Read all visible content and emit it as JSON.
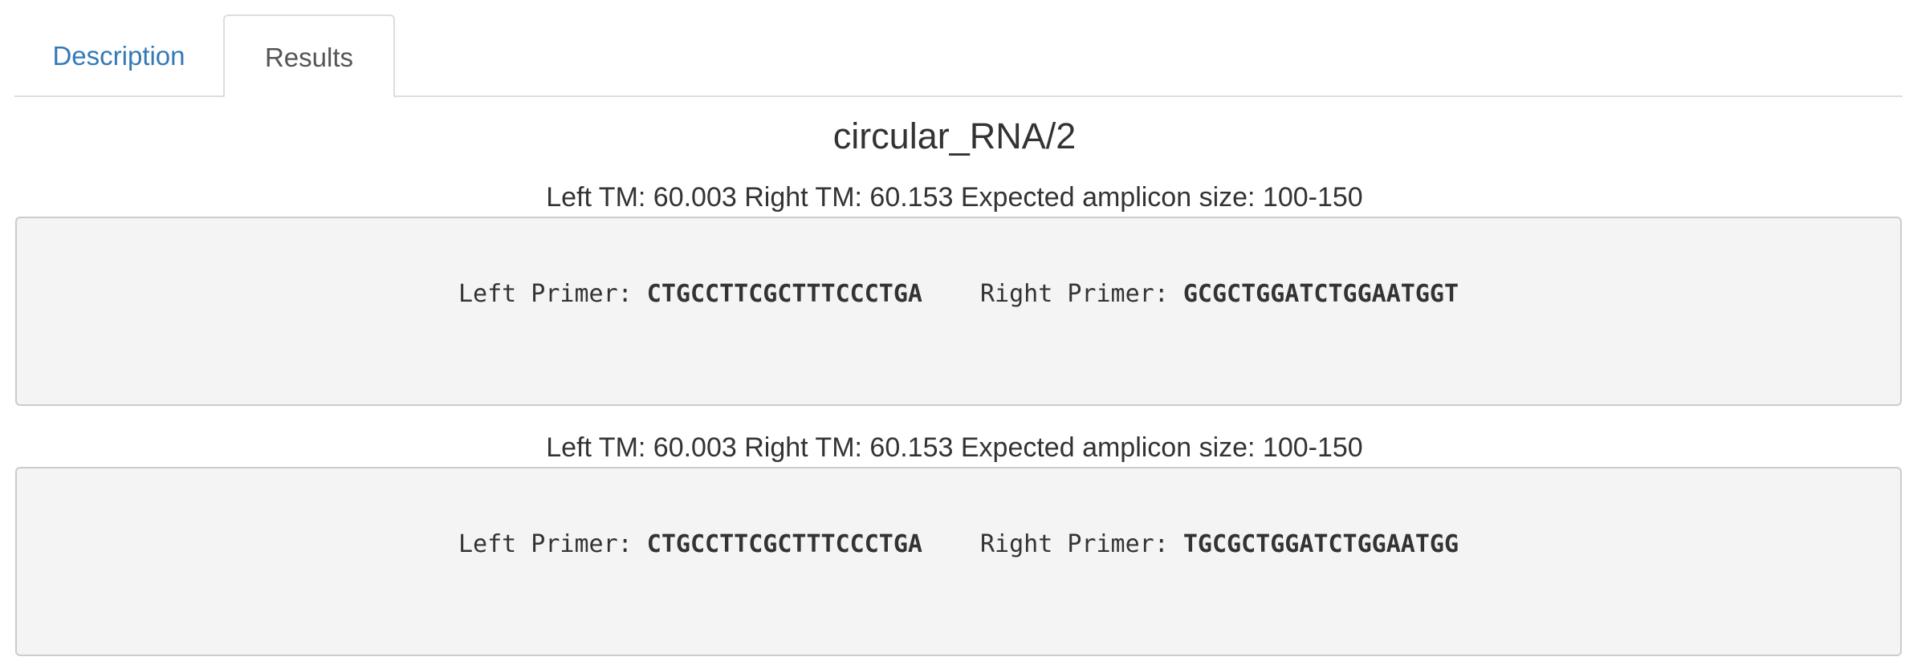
{
  "tabs": [
    {
      "label": "Description",
      "active": false
    },
    {
      "label": "Results",
      "active": true
    }
  ],
  "title": "circular_RNA/2",
  "results": [
    {
      "info": "Left TM: 60.003 Right TM: 60.153 Expected amplicon size: 100-150",
      "left_label": "Left Primer: ",
      "left_seq": "CTGCCTTCGCTTTCCCTGA",
      "right_label": "Right Primer: ",
      "right_seq": "GCGCTGGATCTGGAATGGT"
    },
    {
      "info": "Left TM: 60.003 Right TM: 60.153 Expected amplicon size: 100-150",
      "left_label": "Left Primer: ",
      "left_seq": "CTGCCTTCGCTTTCCCTGA",
      "right_label": "Right Primer: ",
      "right_seq": "TGCGCTGGATCTGGAATGG"
    }
  ],
  "colors": {
    "link": "#337ab7",
    "text": "#333333",
    "box_bg": "#f4f4f4",
    "border": "#dddddd"
  }
}
